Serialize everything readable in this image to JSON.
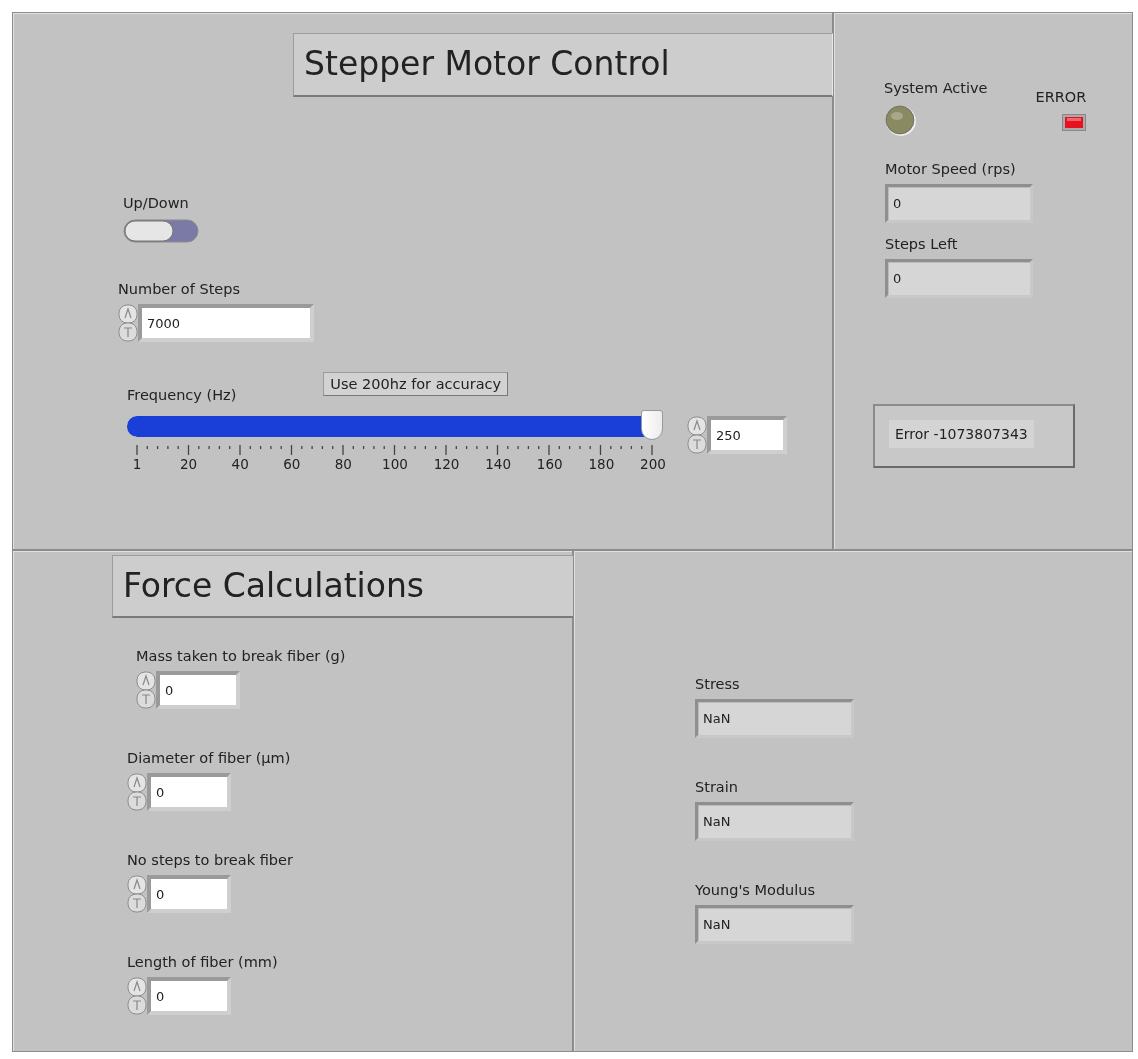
{
  "motor": {
    "title": "Stepper Motor Control",
    "up_down": {
      "label": "Up/Down",
      "on": false
    },
    "number_of_steps": {
      "label": "Number of Steps",
      "value": "7000"
    },
    "note": "Use 200hz for accuracy",
    "frequency": {
      "label": "Frequency (Hz)",
      "level": 1,
      "ticks": [
        "1",
        "20",
        "40",
        "60",
        "80",
        "100",
        "120",
        "140",
        "160",
        "180",
        "200"
      ],
      "value": "250"
    }
  },
  "status": {
    "system_active": {
      "label": "System Active",
      "on": false
    },
    "error_led": {
      "label": "ERROR",
      "on": true
    },
    "indicators": [
      {
        "label": "Motor Speed (rps)",
        "value": "0"
      },
      {
        "label": "Steps Left",
        "value": "0"
      }
    ],
    "error_message": "Error -1073807343"
  },
  "force": {
    "title": "Force Calculations",
    "inputs": [
      {
        "label": "Mass taken to break fiber (g)",
        "value": "0"
      },
      {
        "label": "Diameter of fiber (µm)",
        "value": "0"
      },
      {
        "label": "No steps to break fiber",
        "value": "0"
      },
      {
        "label": "Length of fiber (mm)",
        "value": "0"
      }
    ]
  },
  "results": [
    {
      "label": "Stress",
      "value": "NaN"
    },
    {
      "label": "Strain",
      "value": "NaN"
    },
    {
      "label": "Young's Modulus",
      "value": "NaN"
    }
  ]
}
